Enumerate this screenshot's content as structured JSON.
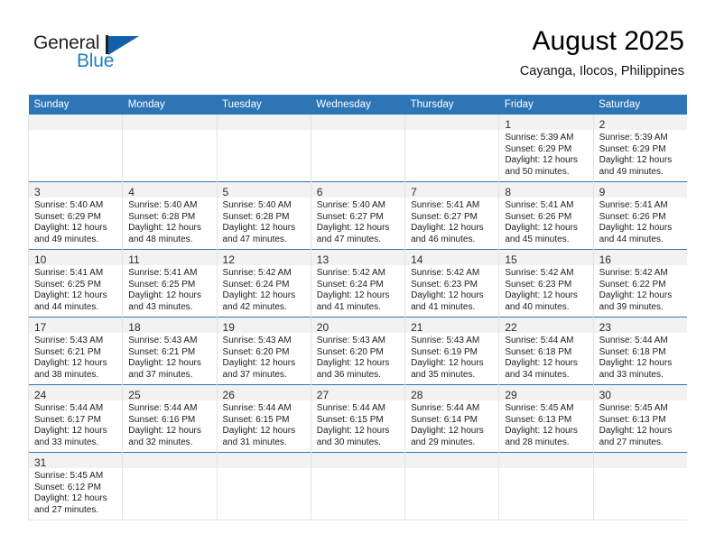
{
  "brand": {
    "name_dark": "General",
    "name_blue": "Blue",
    "accent_blue": "#1f7fc4",
    "triangle_blue": "#1261a8"
  },
  "header": {
    "title": "August 2025",
    "subtitle": "Cayanga, Ilocos, Philippines",
    "header_bg": "#2e75b6",
    "daynum_band_bg": "#f2f2f2"
  },
  "weekdays": [
    "Sunday",
    "Monday",
    "Tuesday",
    "Wednesday",
    "Thursday",
    "Friday",
    "Saturday"
  ],
  "weeks": [
    [
      {
        "empty": true
      },
      {
        "empty": true
      },
      {
        "empty": true
      },
      {
        "empty": true
      },
      {
        "empty": true
      },
      {
        "day": "1",
        "sunrise": "Sunrise: 5:39 AM",
        "sunset": "Sunset: 6:29 PM",
        "daylight1": "Daylight: 12 hours",
        "daylight2": "and 50 minutes."
      },
      {
        "day": "2",
        "sunrise": "Sunrise: 5:39 AM",
        "sunset": "Sunset: 6:29 PM",
        "daylight1": "Daylight: 12 hours",
        "daylight2": "and 49 minutes."
      }
    ],
    [
      {
        "day": "3",
        "sunrise": "Sunrise: 5:40 AM",
        "sunset": "Sunset: 6:29 PM",
        "daylight1": "Daylight: 12 hours",
        "daylight2": "and 49 minutes."
      },
      {
        "day": "4",
        "sunrise": "Sunrise: 5:40 AM",
        "sunset": "Sunset: 6:28 PM",
        "daylight1": "Daylight: 12 hours",
        "daylight2": "and 48 minutes."
      },
      {
        "day": "5",
        "sunrise": "Sunrise: 5:40 AM",
        "sunset": "Sunset: 6:28 PM",
        "daylight1": "Daylight: 12 hours",
        "daylight2": "and 47 minutes."
      },
      {
        "day": "6",
        "sunrise": "Sunrise: 5:40 AM",
        "sunset": "Sunset: 6:27 PM",
        "daylight1": "Daylight: 12 hours",
        "daylight2": "and 47 minutes."
      },
      {
        "day": "7",
        "sunrise": "Sunrise: 5:41 AM",
        "sunset": "Sunset: 6:27 PM",
        "daylight1": "Daylight: 12 hours",
        "daylight2": "and 46 minutes."
      },
      {
        "day": "8",
        "sunrise": "Sunrise: 5:41 AM",
        "sunset": "Sunset: 6:26 PM",
        "daylight1": "Daylight: 12 hours",
        "daylight2": "and 45 minutes."
      },
      {
        "day": "9",
        "sunrise": "Sunrise: 5:41 AM",
        "sunset": "Sunset: 6:26 PM",
        "daylight1": "Daylight: 12 hours",
        "daylight2": "and 44 minutes."
      }
    ],
    [
      {
        "day": "10",
        "sunrise": "Sunrise: 5:41 AM",
        "sunset": "Sunset: 6:25 PM",
        "daylight1": "Daylight: 12 hours",
        "daylight2": "and 44 minutes."
      },
      {
        "day": "11",
        "sunrise": "Sunrise: 5:41 AM",
        "sunset": "Sunset: 6:25 PM",
        "daylight1": "Daylight: 12 hours",
        "daylight2": "and 43 minutes."
      },
      {
        "day": "12",
        "sunrise": "Sunrise: 5:42 AM",
        "sunset": "Sunset: 6:24 PM",
        "daylight1": "Daylight: 12 hours",
        "daylight2": "and 42 minutes."
      },
      {
        "day": "13",
        "sunrise": "Sunrise: 5:42 AM",
        "sunset": "Sunset: 6:24 PM",
        "daylight1": "Daylight: 12 hours",
        "daylight2": "and 41 minutes."
      },
      {
        "day": "14",
        "sunrise": "Sunrise: 5:42 AM",
        "sunset": "Sunset: 6:23 PM",
        "daylight1": "Daylight: 12 hours",
        "daylight2": "and 41 minutes."
      },
      {
        "day": "15",
        "sunrise": "Sunrise: 5:42 AM",
        "sunset": "Sunset: 6:23 PM",
        "daylight1": "Daylight: 12 hours",
        "daylight2": "and 40 minutes."
      },
      {
        "day": "16",
        "sunrise": "Sunrise: 5:42 AM",
        "sunset": "Sunset: 6:22 PM",
        "daylight1": "Daylight: 12 hours",
        "daylight2": "and 39 minutes."
      }
    ],
    [
      {
        "day": "17",
        "sunrise": "Sunrise: 5:43 AM",
        "sunset": "Sunset: 6:21 PM",
        "daylight1": "Daylight: 12 hours",
        "daylight2": "and 38 minutes."
      },
      {
        "day": "18",
        "sunrise": "Sunrise: 5:43 AM",
        "sunset": "Sunset: 6:21 PM",
        "daylight1": "Daylight: 12 hours",
        "daylight2": "and 37 minutes."
      },
      {
        "day": "19",
        "sunrise": "Sunrise: 5:43 AM",
        "sunset": "Sunset: 6:20 PM",
        "daylight1": "Daylight: 12 hours",
        "daylight2": "and 37 minutes."
      },
      {
        "day": "20",
        "sunrise": "Sunrise: 5:43 AM",
        "sunset": "Sunset: 6:20 PM",
        "daylight1": "Daylight: 12 hours",
        "daylight2": "and 36 minutes."
      },
      {
        "day": "21",
        "sunrise": "Sunrise: 5:43 AM",
        "sunset": "Sunset: 6:19 PM",
        "daylight1": "Daylight: 12 hours",
        "daylight2": "and 35 minutes."
      },
      {
        "day": "22",
        "sunrise": "Sunrise: 5:44 AM",
        "sunset": "Sunset: 6:18 PM",
        "daylight1": "Daylight: 12 hours",
        "daylight2": "and 34 minutes."
      },
      {
        "day": "23",
        "sunrise": "Sunrise: 5:44 AM",
        "sunset": "Sunset: 6:18 PM",
        "daylight1": "Daylight: 12 hours",
        "daylight2": "and 33 minutes."
      }
    ],
    [
      {
        "day": "24",
        "sunrise": "Sunrise: 5:44 AM",
        "sunset": "Sunset: 6:17 PM",
        "daylight1": "Daylight: 12 hours",
        "daylight2": "and 33 minutes."
      },
      {
        "day": "25",
        "sunrise": "Sunrise: 5:44 AM",
        "sunset": "Sunset: 6:16 PM",
        "daylight1": "Daylight: 12 hours",
        "daylight2": "and 32 minutes."
      },
      {
        "day": "26",
        "sunrise": "Sunrise: 5:44 AM",
        "sunset": "Sunset: 6:15 PM",
        "daylight1": "Daylight: 12 hours",
        "daylight2": "and 31 minutes."
      },
      {
        "day": "27",
        "sunrise": "Sunrise: 5:44 AM",
        "sunset": "Sunset: 6:15 PM",
        "daylight1": "Daylight: 12 hours",
        "daylight2": "and 30 minutes."
      },
      {
        "day": "28",
        "sunrise": "Sunrise: 5:44 AM",
        "sunset": "Sunset: 6:14 PM",
        "daylight1": "Daylight: 12 hours",
        "daylight2": "and 29 minutes."
      },
      {
        "day": "29",
        "sunrise": "Sunrise: 5:45 AM",
        "sunset": "Sunset: 6:13 PM",
        "daylight1": "Daylight: 12 hours",
        "daylight2": "and 28 minutes."
      },
      {
        "day": "30",
        "sunrise": "Sunrise: 5:45 AM",
        "sunset": "Sunset: 6:13 PM",
        "daylight1": "Daylight: 12 hours",
        "daylight2": "and 27 minutes."
      }
    ],
    [
      {
        "day": "31",
        "sunrise": "Sunrise: 5:45 AM",
        "sunset": "Sunset: 6:12 PM",
        "daylight1": "Daylight: 12 hours",
        "daylight2": "and 27 minutes."
      },
      {
        "empty": true
      },
      {
        "empty": true
      },
      {
        "empty": true
      },
      {
        "empty": true
      },
      {
        "empty": true
      },
      {
        "empty": true
      }
    ]
  ]
}
